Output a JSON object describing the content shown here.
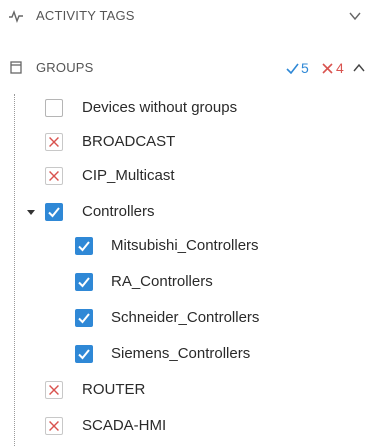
{
  "activity_section": {
    "title": "ACTIVITY TAGS",
    "icon": "activity-pulse-icon",
    "toggle_icon": "chevron-down-icon"
  },
  "groups_section": {
    "title": "GROUPS",
    "icon": "window-icon",
    "included_count": "5",
    "excluded_count": "4",
    "toggle_icon": "chevron-up-icon",
    "colors": {
      "check": "#2f88d6",
      "excluded": "#d9534f"
    }
  },
  "groups": [
    {
      "label": "Devices without groups",
      "state": "empty"
    },
    {
      "label": "BROADCAST",
      "state": "excluded"
    },
    {
      "label": "CIP_Multicast",
      "state": "excluded"
    },
    {
      "label": "Controllers",
      "state": "checked",
      "expanded": true,
      "children": [
        {
          "label": "Mitsubishi_Controllers",
          "state": "checked"
        },
        {
          "label": "RA_Controllers",
          "state": "checked"
        },
        {
          "label": "Schneider_Controllers",
          "state": "checked"
        },
        {
          "label": "Siemens_Controllers",
          "state": "checked"
        }
      ]
    },
    {
      "label": "ROUTER",
      "state": "excluded"
    },
    {
      "label": "SCADA-HMI",
      "state": "excluded"
    }
  ]
}
